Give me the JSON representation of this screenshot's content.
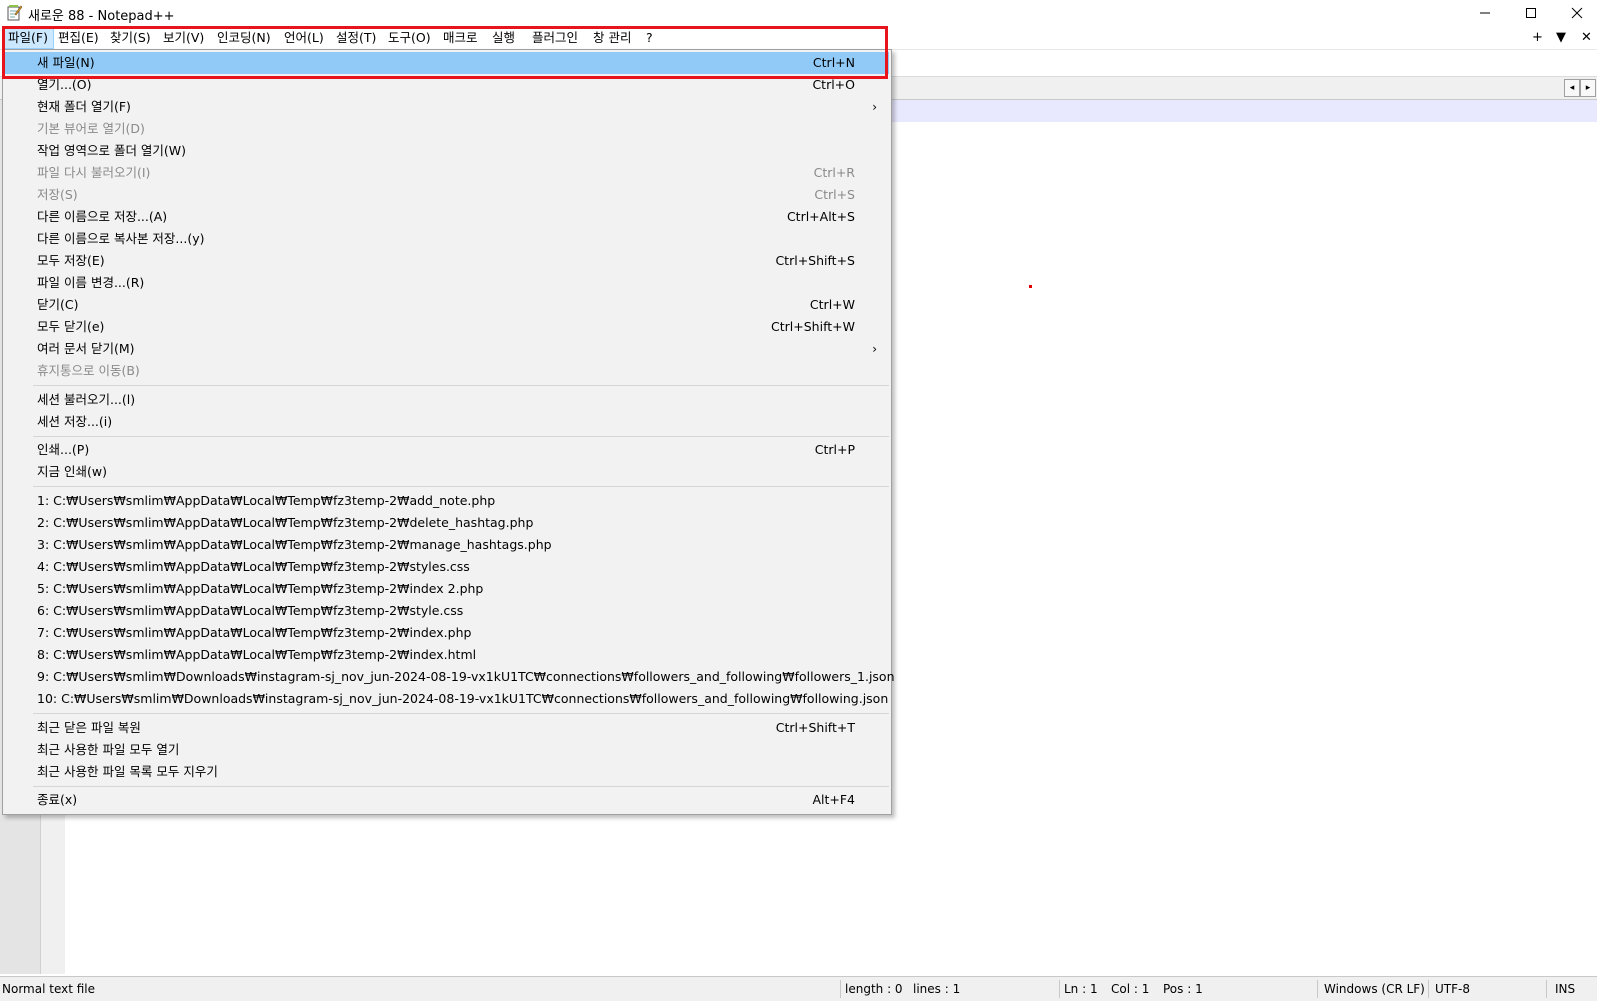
{
  "window": {
    "title": "새로운 88 - Notepad++",
    "icon": "notepad-icon",
    "controls": {
      "minimize_icon": "minimize-icon",
      "maximize_icon": "maximize-icon",
      "close_icon": "close-icon"
    }
  },
  "menubar": {
    "items": [
      "파일(F)",
      "편집(E)",
      "찾기(S)",
      "보기(V)",
      "인코딩(N)",
      "언어(L)",
      "설정(T)",
      "도구(O)",
      "매크로",
      "실행",
      "플러그인",
      "창 관리",
      "?"
    ],
    "active_index": 0,
    "right_controls": [
      "+",
      "▼",
      "✕"
    ]
  },
  "file_menu": {
    "items": [
      {
        "label": "새 파일(N)",
        "shortcut": "Ctrl+N",
        "highlighted": true
      },
      {
        "label": "열기...(O)",
        "shortcut": "Ctrl+O"
      },
      {
        "label": "현재 폴더 열기(F)",
        "shortcut": "",
        "submenu": true
      },
      {
        "label": "기본 뷰어로 열기(D)",
        "shortcut": "",
        "disabled": true
      },
      {
        "label": "작업 영역으로 폴더 열기(W)",
        "shortcut": ""
      },
      {
        "label": "파일 다시 불러오기(I)",
        "shortcut": "Ctrl+R",
        "disabled": true
      },
      {
        "label": "저장(S)",
        "shortcut": "Ctrl+S",
        "disabled": true
      },
      {
        "label": "다른 이름으로 저장...(A)",
        "shortcut": "Ctrl+Alt+S"
      },
      {
        "label": "다른 이름으로 복사본 저장...(y)",
        "shortcut": ""
      },
      {
        "label": "모두 저장(E)",
        "shortcut": "Ctrl+Shift+S"
      },
      {
        "label": "파일 이름 변경...(R)",
        "shortcut": ""
      },
      {
        "label": "닫기(C)",
        "shortcut": "Ctrl+W"
      },
      {
        "label": "모두 닫기(e)",
        "shortcut": "Ctrl+Shift+W"
      },
      {
        "label": "여러 문서 닫기(M)",
        "shortcut": "",
        "submenu": true
      },
      {
        "label": "휴지통으로 이동(B)",
        "shortcut": "",
        "disabled": true
      },
      {
        "label": "세션 불러오기...(l)",
        "shortcut": ""
      },
      {
        "label": "세션 저장...(i)",
        "shortcut": ""
      },
      {
        "label": "인쇄...(P)",
        "shortcut": "Ctrl+P"
      },
      {
        "label": "지금 인쇄(w)",
        "shortcut": ""
      },
      {
        "label": "1: C:₩Users₩smlim₩AppData₩Local₩Temp₩fz3temp-2₩add_note.php",
        "shortcut": ""
      },
      {
        "label": "2: C:₩Users₩smlim₩AppData₩Local₩Temp₩fz3temp-2₩delete_hashtag.php",
        "shortcut": ""
      },
      {
        "label": "3: C:₩Users₩smlim₩AppData₩Local₩Temp₩fz3temp-2₩manage_hashtags.php",
        "shortcut": ""
      },
      {
        "label": "4: C:₩Users₩smlim₩AppData₩Local₩Temp₩fz3temp-2₩styles.css",
        "shortcut": ""
      },
      {
        "label": "5: C:₩Users₩smlim₩AppData₩Local₩Temp₩fz3temp-2₩index 2.php",
        "shortcut": ""
      },
      {
        "label": "6: C:₩Users₩smlim₩AppData₩Local₩Temp₩fz3temp-2₩style.css",
        "shortcut": ""
      },
      {
        "label": "7: C:₩Users₩smlim₩AppData₩Local₩Temp₩fz3temp-2₩index.php",
        "shortcut": ""
      },
      {
        "label": "8: C:₩Users₩smlim₩AppData₩Local₩Temp₩fz3temp-2₩index.html",
        "shortcut": ""
      },
      {
        "label": "9: C:₩Users₩smlim₩Downloads₩instagram-sj_nov_jun-2024-08-19-vx1kU1TC₩connections₩followers_and_following₩followers_1.json",
        "shortcut": ""
      },
      {
        "label": "10: C:₩Users₩smlim₩Downloads₩instagram-sj_nov_jun-2024-08-19-vx1kU1TC₩connections₩followers_and_following₩following.json",
        "shortcut": ""
      },
      {
        "label": "최근 닫은 파일 복원",
        "shortcut": "Ctrl+Shift+T"
      },
      {
        "label": "최근 사용한 파일 모두 열기",
        "shortcut": ""
      },
      {
        "label": "최근 사용한 파일 목록 모두 지우기",
        "shortcut": ""
      },
      {
        "label": "종료(x)",
        "shortcut": "Alt+F4"
      }
    ],
    "submenu_arrow": "›"
  },
  "statusbar": {
    "file_type": "Normal text file",
    "length": "length : 0",
    "lines": "lines : 1",
    "ln": "Ln : 1",
    "col": "Col : 1",
    "pos": "Pos : 1",
    "eol": "Windows (CR LF)",
    "encoding": "UTF-8",
    "mode": "INS"
  },
  "colors": {
    "menu_highlight": "#91c9f7",
    "annotation_box": "#e8141c",
    "current_line": "#e8e8ff"
  }
}
